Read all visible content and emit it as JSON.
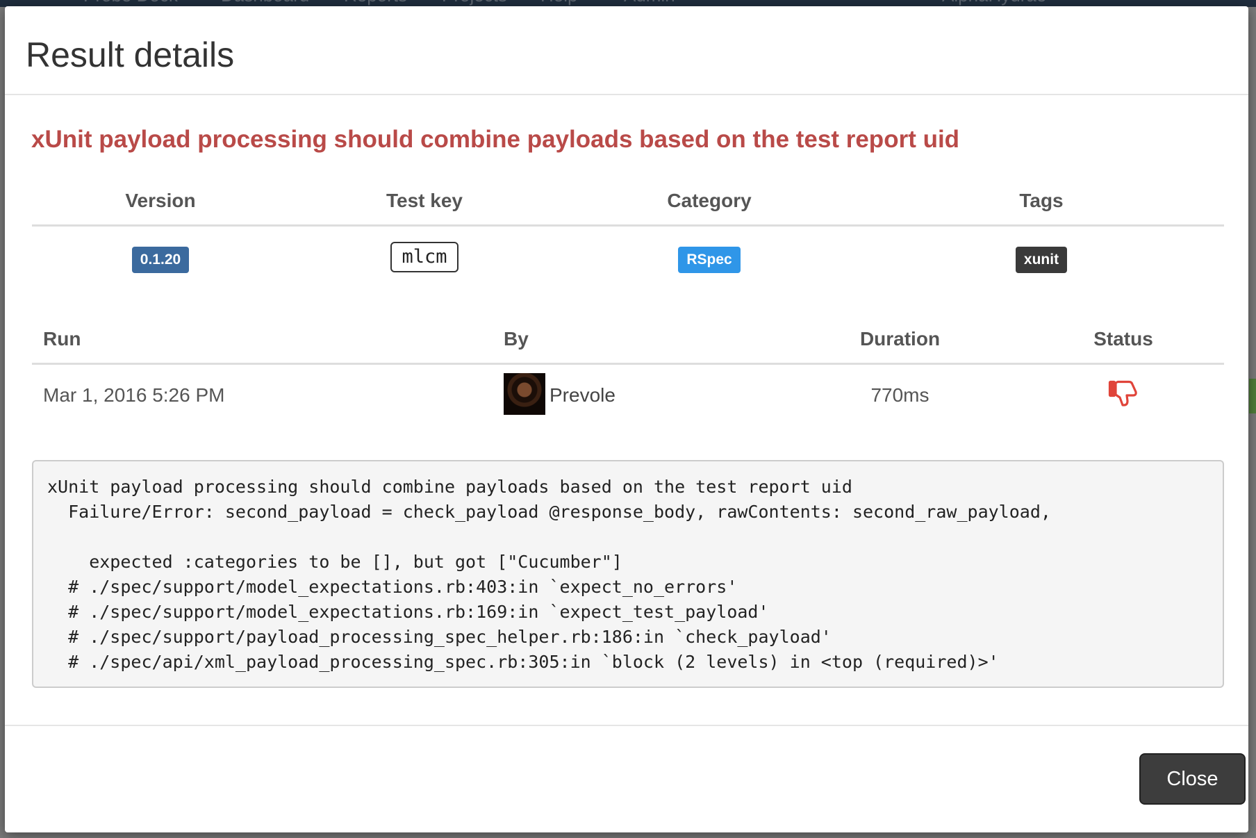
{
  "background_nav": {
    "items": [
      "Probe Dock",
      "Dashboard",
      "Reports",
      "Projects",
      "Help",
      "Admin",
      "AlphaHydrae"
    ]
  },
  "modal": {
    "title": "Result details",
    "test_name": "xUnit payload processing should combine payloads based on the test report uid",
    "meta": {
      "headers": {
        "version": "Version",
        "test_key": "Test key",
        "category": "Category",
        "tags": "Tags"
      },
      "version": "0.1.20",
      "test_key": "mlcm",
      "category": "RSpec",
      "tag": "xunit"
    },
    "run": {
      "headers": {
        "run": "Run",
        "by": "By",
        "duration": "Duration",
        "status": "Status"
      },
      "date": "Mar 1, 2016 5:26 PM",
      "user": "Prevole",
      "duration": "770ms",
      "status_icon": "thumbs-down-icon"
    },
    "stacktrace": "xUnit payload processing should combine payloads based on the test report uid\n  Failure/Error: second_payload = check_payload @response_body, rawContents: second_raw_payload,\n\n    expected :categories to be [], but got [\"Cucumber\"]\n  # ./spec/support/model_expectations.rb:403:in `expect_no_errors'\n  # ./spec/support/model_expectations.rb:169:in `expect_test_payload'\n  # ./spec/support/payload_processing_spec_helper.rb:186:in `check_payload'\n  # ./spec/api/xml_payload_processing_spec.rb:305:in `block (2 levels) in <top (required)>'",
    "close_label": "Close"
  },
  "colors": {
    "test_name": "#b94a48",
    "version_badge": "#3b6a9e",
    "category_badge": "#2f96e8",
    "tag_badge": "#3a3a3a",
    "status_failed": "#e0443a"
  }
}
